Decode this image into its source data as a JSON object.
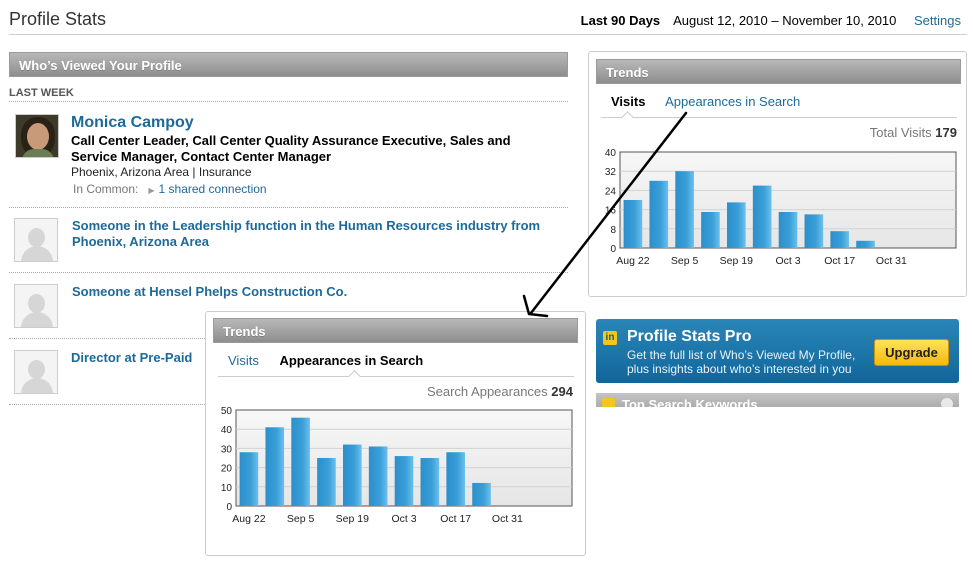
{
  "header": {
    "title": "Profile Stats",
    "period_label": "Last 90 Days",
    "date_range": "August 12, 2010 – November 10, 2010",
    "settings_label": "Settings"
  },
  "viewers": {
    "section_title": "Who’s Viewed Your Profile",
    "period_label": "LAST WEEK",
    "items": [
      {
        "name": "Monica Campoy",
        "title": "Call Center Leader, Call Center Quality Assurance Executive, Sales and Service Manager, Contact Center Manager",
        "location": "Phoenix, Arizona Area | Insurance",
        "in_common_label": "In Common:",
        "in_common_link": "1 shared connection"
      },
      {
        "name": "Someone in the Leadership function in the Human Resources industry from Phoenix, Arizona Area"
      },
      {
        "name": "Someone at Hensel Phelps Construction Co."
      },
      {
        "name": "Director at Pre-Paid"
      }
    ]
  },
  "trends_visits": {
    "title": "Trends",
    "tabs": [
      {
        "label": "Visits",
        "active": true
      },
      {
        "label": "Appearances in Search",
        "active": false
      }
    ],
    "total_label": "Total Visits",
    "total_value": "179",
    "chart_data": {
      "type": "bar",
      "categories": [
        "Aug 22",
        "",
        "Sep 5",
        "",
        "Sep 19",
        "",
        "Oct 3",
        "",
        "Oct 17",
        "",
        "Oct 31",
        "",
        ""
      ],
      "values": [
        20,
        28,
        32,
        15,
        19,
        26,
        15,
        14,
        7,
        3,
        0,
        0,
        0
      ],
      "xlabel": "",
      "ylabel": "",
      "ylim": [
        0,
        40
      ],
      "yticks": [
        0,
        8,
        16,
        24,
        32,
        40
      ],
      "xtick_labels": [
        "Aug 22",
        "Sep 5",
        "Sep 19",
        "Oct 3",
        "Oct 17",
        "Oct 31"
      ],
      "grid": true,
      "bar_color": "#3a9fd8"
    }
  },
  "trends_search": {
    "title": "Trends",
    "tabs": [
      {
        "label": "Visits",
        "active": false
      },
      {
        "label": "Appearances in Search",
        "active": true
      }
    ],
    "total_label": "Search Appearances",
    "total_value": "294",
    "chart_data": {
      "type": "bar",
      "categories": [
        "Aug 22",
        "",
        "Sep 5",
        "",
        "Sep 19",
        "",
        "Oct 3",
        "",
        "Oct 17",
        "",
        "Oct 31",
        "",
        ""
      ],
      "values": [
        28,
        41,
        46,
        25,
        32,
        31,
        26,
        25,
        28,
        12,
        0,
        0,
        0
      ],
      "xlabel": "",
      "ylabel": "",
      "ylim": [
        0,
        50
      ],
      "yticks": [
        0,
        10,
        20,
        30,
        40,
        50
      ],
      "xtick_labels": [
        "Aug 22",
        "Sep 5",
        "Sep 19",
        "Oct 3",
        "Oct 17",
        "Oct 31"
      ],
      "grid": true,
      "bar_color": "#3a9fd8"
    }
  },
  "promo": {
    "title": "Profile Stats Pro",
    "icon": "in",
    "description_line1": "Get the full list of Who’s Viewed My Profile,",
    "description_line2": "plus insights about who’s interested in you",
    "button_label": "Upgrade"
  },
  "keywords": {
    "title": "Top Search Keywords",
    "icon": "in"
  },
  "colors": {
    "link": "#1d6a99",
    "bar": "#3a9fd8",
    "promo": "#1a78ad",
    "upgrade": "#f6c81e"
  }
}
